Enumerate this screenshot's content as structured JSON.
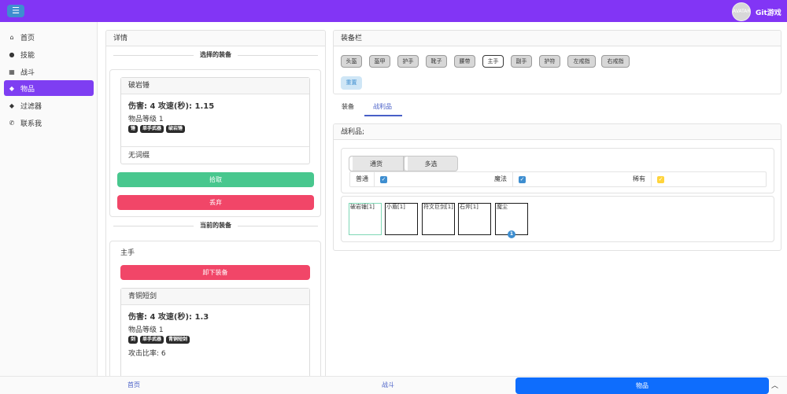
{
  "header": {
    "menu_icon": "hamburger-icon",
    "avatar_text": "AVATAR",
    "brand": "Git游戏"
  },
  "sidebar": {
    "items": [
      {
        "label": "首页",
        "icon": "home-icon",
        "glyph": "⌂"
      },
      {
        "label": "技能",
        "icon": "skill-icon",
        "glyph": "●"
      },
      {
        "label": "战斗",
        "icon": "map-icon",
        "glyph": "▦"
      },
      {
        "label": "物品",
        "icon": "gem-icon",
        "glyph": "◆"
      },
      {
        "label": "过滤器",
        "icon": "filter-icon",
        "glyph": "◆"
      },
      {
        "label": "联系我",
        "icon": "phone-icon",
        "glyph": "✆"
      }
    ],
    "active": "物品"
  },
  "details": {
    "title": "详情",
    "selected_header": "选择的装备",
    "selected_item": {
      "name": "破岩锤",
      "stat": "伤害: 4 攻速(秒): 1.15",
      "level": "物品等级 1",
      "tags": [
        "锤",
        "单手武器",
        "破岩锤"
      ],
      "affix": "无词缀"
    },
    "pick_button": "拾取",
    "discard_button": "丢弃",
    "current_header": "当前的装备",
    "current_slot": "主手",
    "unequip_button": "卸下装备",
    "current_item": {
      "name": "青铜短剑",
      "stat": "伤害: 4 攻速(秒): 1.3",
      "level": "物品等级 1",
      "tags": [
        "剑",
        "单手武器",
        "青铜短剑"
      ],
      "extra": "攻击比率: 6"
    }
  },
  "equipment": {
    "title": "装备栏",
    "slots": [
      "头盔",
      "盔甲",
      "护手",
      "靴子",
      "腰带",
      "主手",
      "副手",
      "护符",
      "左戒指",
      "右戒指"
    ],
    "selected_slot": "主手",
    "reset_button": "重置"
  },
  "tabs": {
    "equip": "装备",
    "loot": "战利品",
    "active": "战利品"
  },
  "loot": {
    "title": "战利品;",
    "segments": [
      "通货",
      "多选"
    ],
    "filters": [
      {
        "label": "普通",
        "checked": true,
        "color": "#3e8ed0"
      },
      {
        "label": "魔法",
        "checked": true,
        "color": "#3e8ed0"
      },
      {
        "label": "稀有",
        "checked": true,
        "color": "#ffd43b"
      }
    ],
    "items": [
      "破岩锤[1]",
      "小盾[1]",
      "符文巨剑[1]",
      "石斧[1]",
      "魔尘"
    ],
    "badge": "1"
  },
  "bottom_nav": {
    "home": "首页",
    "battle": "战斗",
    "items": "物品",
    "up_icon": "chevron-up-icon"
  },
  "colors": {
    "header": "#8235f5",
    "active_nav": "#7e3ef2",
    "bottom_active": "#0e6dfd",
    "pick": "#48c78e",
    "discard": "#f14668"
  }
}
